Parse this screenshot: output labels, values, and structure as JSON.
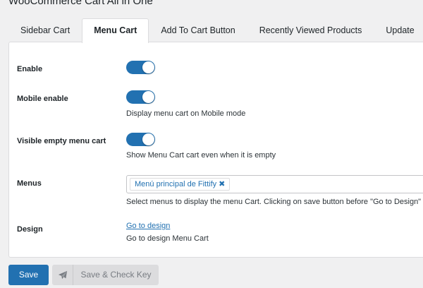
{
  "page": {
    "title": "WooCommerce Cart All in One"
  },
  "tabs": [
    {
      "label": "Sidebar Cart",
      "active": false
    },
    {
      "label": "Menu Cart",
      "active": true
    },
    {
      "label": "Add To Cart Button",
      "active": false
    },
    {
      "label": "Recently Viewed Products",
      "active": false
    },
    {
      "label": "Update",
      "active": false
    }
  ],
  "settings": {
    "enable": {
      "label": "Enable",
      "checked": true
    },
    "mobile_enable": {
      "label": "Mobile enable",
      "checked": true,
      "description": "Display menu cart on Mobile mode"
    },
    "visible_empty": {
      "label": "Visible empty menu cart",
      "checked": true,
      "description": "Show Menu Cart cart even when it is empty"
    },
    "menus": {
      "label": "Menus",
      "selected": [
        "Menú principal de Fittify"
      ],
      "remove_glyph": "✖",
      "description": "Select menus to display the menu Cart. Clicking on save button before \"Go to Design\""
    },
    "design": {
      "label": "Design",
      "link_text": "Go to design",
      "description": "Go to design Menu Cart"
    }
  },
  "footer": {
    "save_label": "Save",
    "check_key_label": "Save & Check Key",
    "check_key_icon": "paper-plane-icon"
  },
  "colors": {
    "accent": "#2271b1",
    "panel_bg": "#ffffff",
    "page_bg": "#f0f0f1"
  }
}
